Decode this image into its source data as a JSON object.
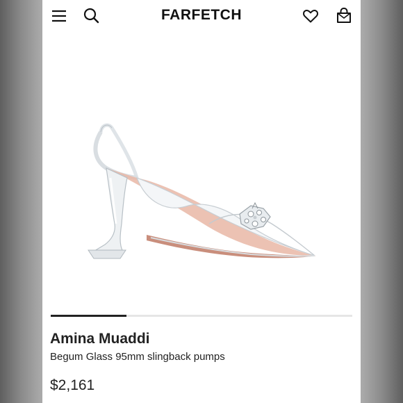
{
  "header": {
    "logo_text": "FARFETCH",
    "icons": [
      "menu-icon",
      "search-icon",
      "heart-icon",
      "bag-icon"
    ]
  },
  "product": {
    "designer": "Amina Muaddi",
    "name": "Begum Glass 95mm slingback pumps",
    "price": "$2,161"
  },
  "carousel": {
    "active_index": 1,
    "total": 4
  },
  "colors": {
    "text": "#222222",
    "background": "#ffffff",
    "frame": "#a9a9a9",
    "indicator_active": "#222222",
    "indicator_track": "#e6e6e6",
    "shoe_lining": "#e9b7a6"
  }
}
